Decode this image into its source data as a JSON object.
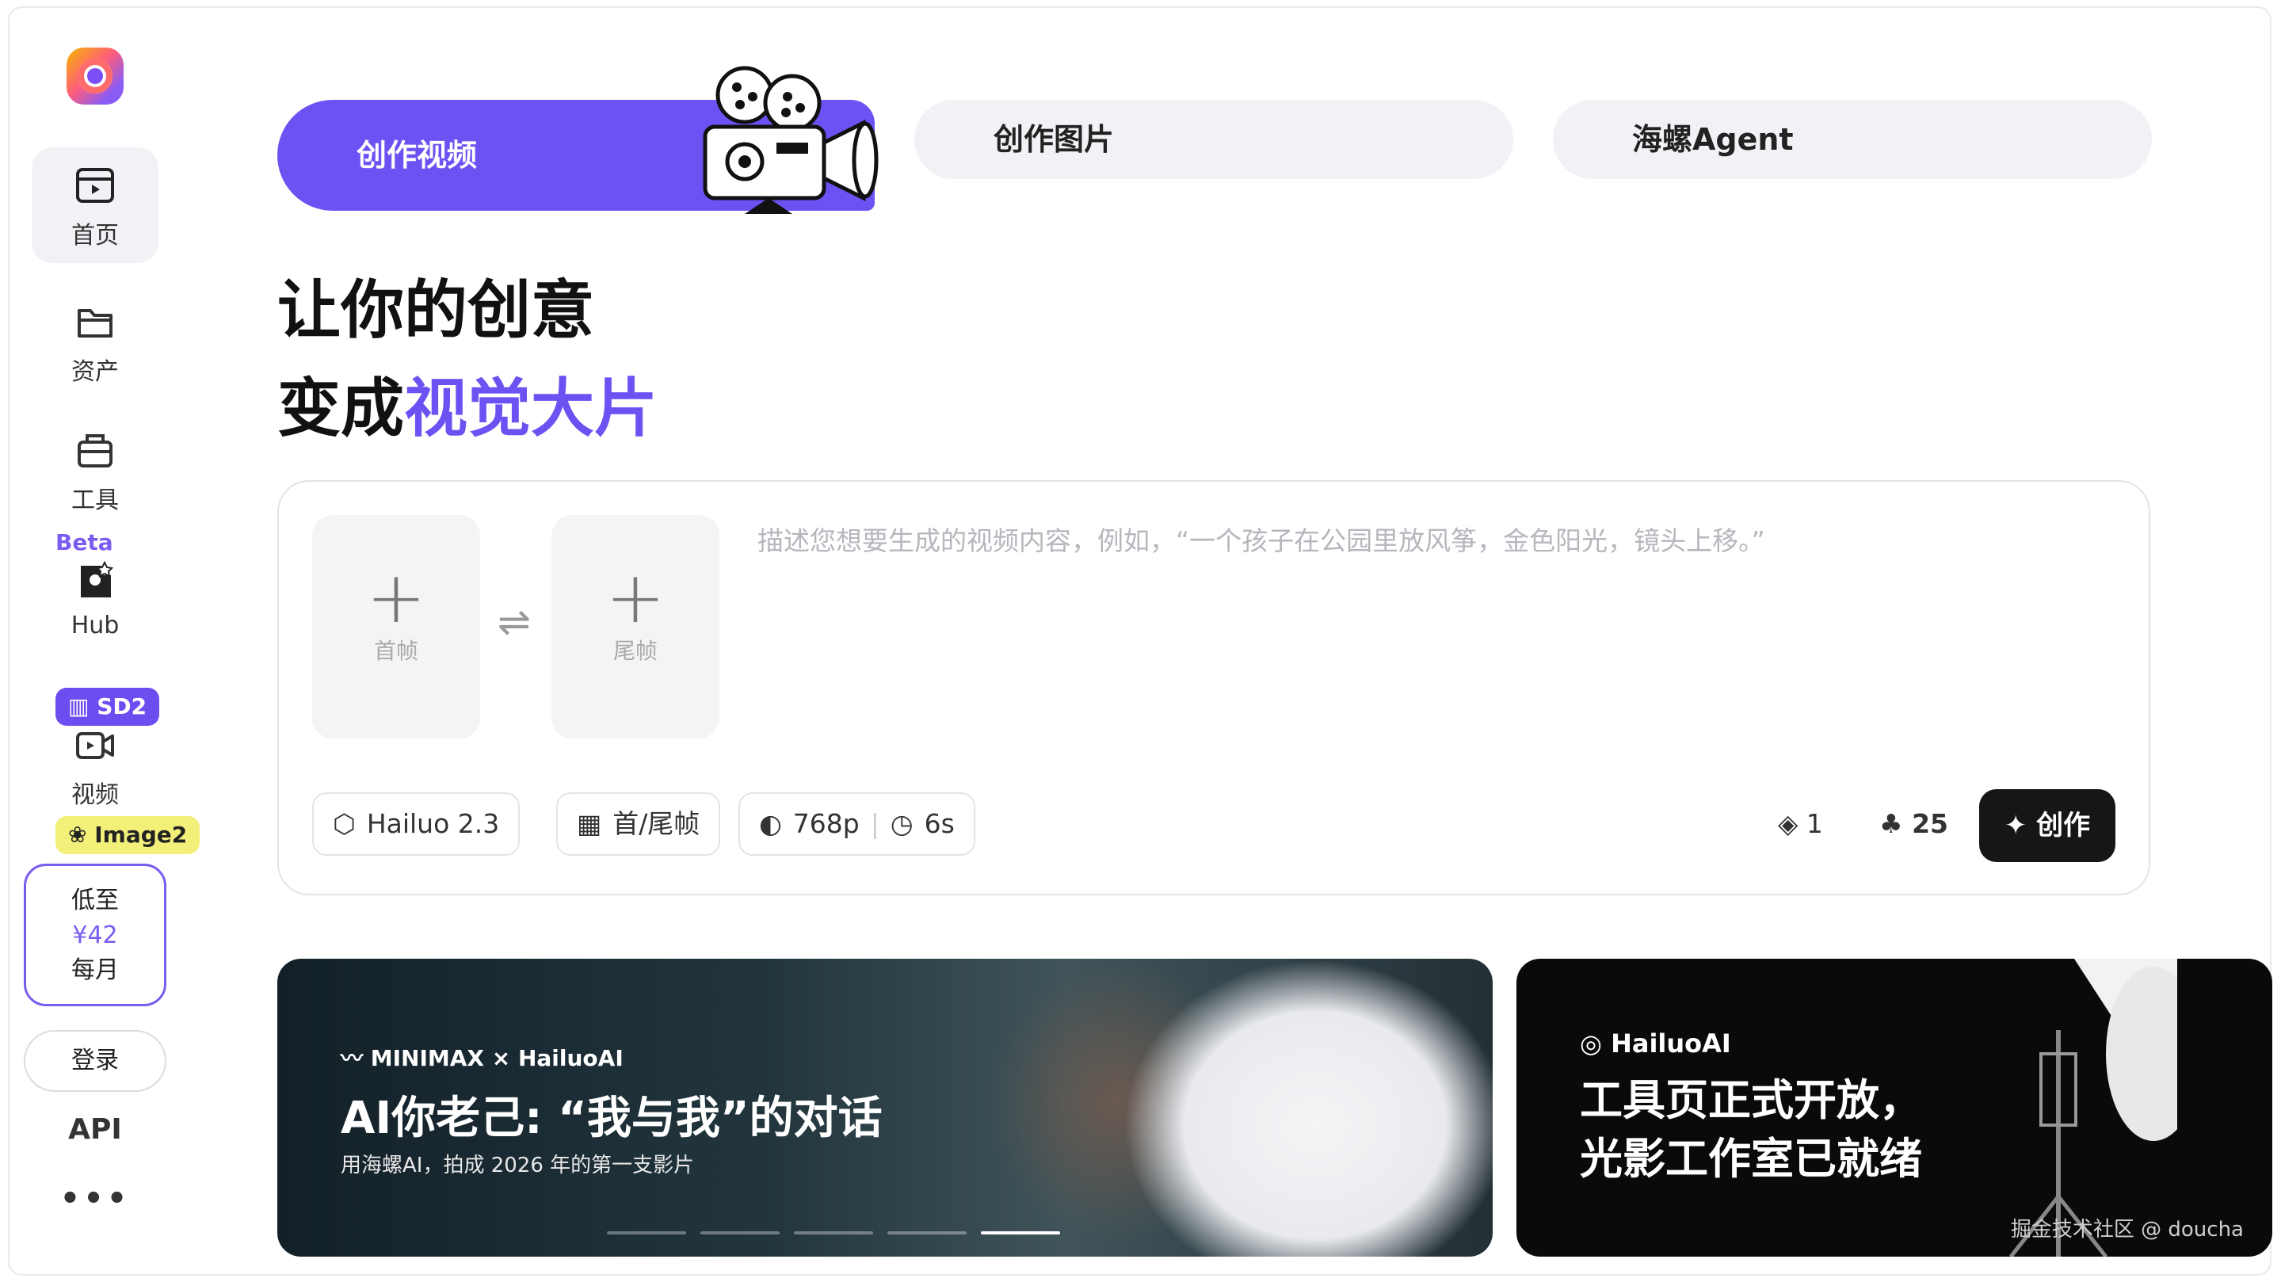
{
  "sidebar": {
    "items": [
      {
        "label": "首页"
      },
      {
        "label": "资产"
      },
      {
        "label": "工具"
      },
      {
        "label": "Hub"
      },
      {
        "label": "视频"
      }
    ],
    "beta_tag": "Beta",
    "sd2_tag": "SD2",
    "image2_tag": "Image2",
    "promo": {
      "line1": "低至",
      "price": "¥42",
      "line3": "每月"
    },
    "login": "登录",
    "api": "API",
    "more": "•••"
  },
  "tabs": [
    {
      "label": "创作视频"
    },
    {
      "label": "创作图片"
    },
    {
      "label": "海螺Agent"
    }
  ],
  "headline": {
    "line1": "让你的创意",
    "line2_prefix": "变成",
    "line2_highlight": "视觉大片"
  },
  "prompt": {
    "first_frame": "首帧",
    "last_frame": "尾帧",
    "placeholder": "描述您想要生成的视频内容，例如，“一个孩子在公园里放风筝，金色阳光，镜头上移。”",
    "model": "Hailuo 2.3",
    "mode": "首/尾帧",
    "resolution": "768p",
    "duration": "6s",
    "count": "1",
    "credits": "25",
    "create": "创作"
  },
  "banners": [
    {
      "brand": "MINIMAX × HailuoAI",
      "title": "AI你老己: “我与我”的对话",
      "subtitle": "用海螺AI，拍成 2026 年的第一支影片"
    },
    {
      "brand": "HailuoAI",
      "title_line1": "工具页正式开放，",
      "title_line2": "光影工作室已就绪",
      "watermark": "掘金技术社区 @ doucha"
    }
  ],
  "colors": {
    "accent": "#6d52f3",
    "dark_button": "#151618",
    "highlight_tag": "#f3f07a"
  }
}
